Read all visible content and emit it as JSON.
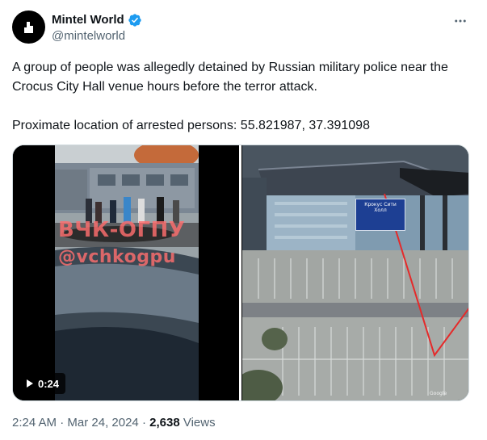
{
  "author": {
    "display_name": "Mintel World",
    "handle": "@mintelworld",
    "verified": true,
    "avatar_icon": "mintel-logo-icon"
  },
  "tweet": {
    "paragraphs": [
      "A group of people was allegedly detained by Russian military police near the Crocus City Hall venue hours before the terror attack.",
      "Proximate location of arrested persons: 55.821987, 37.391098"
    ]
  },
  "media": {
    "video": {
      "duration": "0:24",
      "watermark_line1": "ВЧК-ОГПУ",
      "watermark_line2": "@vchkogpu"
    },
    "map": {
      "sign_text": "Крокус Сити Холл",
      "credit": "Google"
    }
  },
  "meta": {
    "time": "2:24 AM",
    "separator": "·",
    "date": "Mar 24, 2024",
    "views_count": "2,638",
    "views_label": "Views"
  },
  "colors": {
    "text": "#0f1419",
    "muted": "#536471",
    "verified": "#1d9bf0",
    "border": "#cfd9de"
  }
}
